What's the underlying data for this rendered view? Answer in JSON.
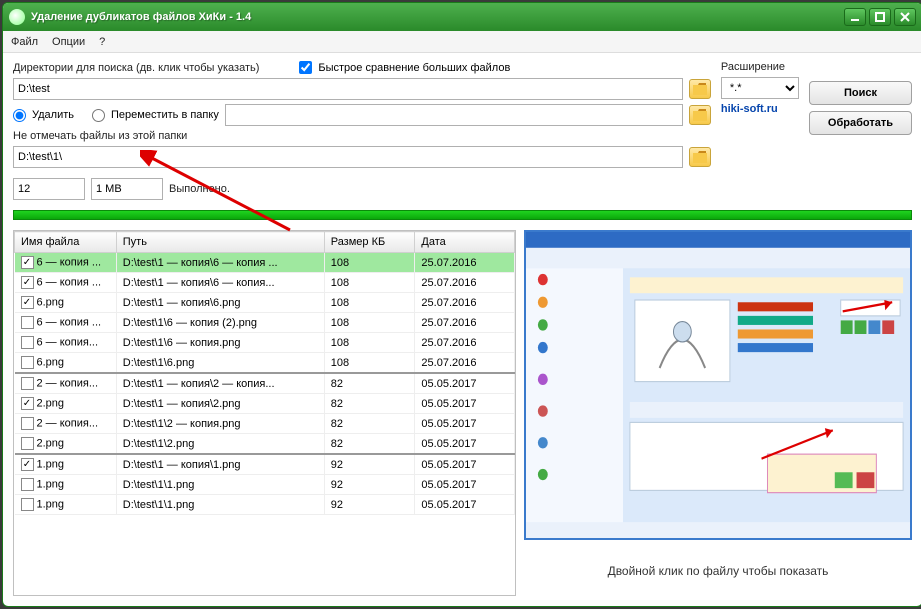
{
  "title": "Удаление дубликатов файлов ХиКи - 1.4",
  "menu": {
    "file": "Файл",
    "options": "Опции",
    "help": "?"
  },
  "labels": {
    "dirs": "Директории для поиска (дв. клик чтобы указать)",
    "fastcmp": "Быстрое сравнение больших файлов",
    "ext": "Расширение",
    "delete": "Удалить",
    "move": "Переместить в папку",
    "exclude": "Не отмечать файлы из этой папки",
    "done": "Выполнено.",
    "preview_hint": "Двойной клик по файлу чтобы показать"
  },
  "inputs": {
    "dirs_value": "D:\\test",
    "move_value": "",
    "exclude_value": "D:\\test\\1\\",
    "count_value": "12",
    "size_value": "1 MB",
    "ext_value": "*.*"
  },
  "buttons": {
    "search": "Поиск",
    "process": "Обработать"
  },
  "link": "hiki-soft.ru",
  "columns": {
    "name": "Имя файла",
    "path": "Путь",
    "size": "Размер КБ",
    "date": "Дата"
  },
  "rows": [
    {
      "checked": true,
      "selected": true,
      "name": "6 — копия ...",
      "path": "D:\\test\\1 — копия\\6 — копия ...",
      "size": "108",
      "date": "25.07.2016",
      "divider": false
    },
    {
      "checked": true,
      "selected": false,
      "name": "6 — копия ...",
      "path": "D:\\test\\1 — копия\\6 — копия...",
      "size": "108",
      "date": "25.07.2016",
      "divider": false
    },
    {
      "checked": true,
      "selected": false,
      "name": "6.png",
      "path": "D:\\test\\1 — копия\\6.png",
      "size": "108",
      "date": "25.07.2016",
      "divider": false
    },
    {
      "checked": false,
      "selected": false,
      "name": "6 — копия ...",
      "path": "D:\\test\\1\\6 — копия (2).png",
      "size": "108",
      "date": "25.07.2016",
      "divider": false
    },
    {
      "checked": false,
      "selected": false,
      "name": "6 — копия...",
      "path": "D:\\test\\1\\6 — копия.png",
      "size": "108",
      "date": "25.07.2016",
      "divider": false
    },
    {
      "checked": false,
      "selected": false,
      "name": "6.png",
      "path": "D:\\test\\1\\6.png",
      "size": "108",
      "date": "25.07.2016",
      "divider": true
    },
    {
      "checked": false,
      "selected": false,
      "name": "2 — копия...",
      "path": "D:\\test\\1 — копия\\2 — копия...",
      "size": "82",
      "date": "05.05.2017",
      "divider": false
    },
    {
      "checked": true,
      "selected": false,
      "name": "2.png",
      "path": "D:\\test\\1 — копия\\2.png",
      "size": "82",
      "date": "05.05.2017",
      "divider": false
    },
    {
      "checked": false,
      "selected": false,
      "name": "2 — копия...",
      "path": "D:\\test\\1\\2 — копия.png",
      "size": "82",
      "date": "05.05.2017",
      "divider": false
    },
    {
      "checked": false,
      "selected": false,
      "name": "2.png",
      "path": "D:\\test\\1\\2.png",
      "size": "82",
      "date": "05.05.2017",
      "divider": true
    },
    {
      "checked": true,
      "selected": false,
      "name": "1.png",
      "path": "D:\\test\\1 — копия\\1.png",
      "size": "92",
      "date": "05.05.2017",
      "divider": false
    },
    {
      "checked": false,
      "selected": false,
      "name": "1.png",
      "path": "D:\\test\\1\\1.png",
      "size": "92",
      "date": "05.05.2017",
      "divider": false
    },
    {
      "checked": false,
      "selected": false,
      "name": "1.png",
      "path": "D:\\test\\1\\1.png",
      "size": "92",
      "date": "05.05.2017",
      "divider": false
    }
  ]
}
